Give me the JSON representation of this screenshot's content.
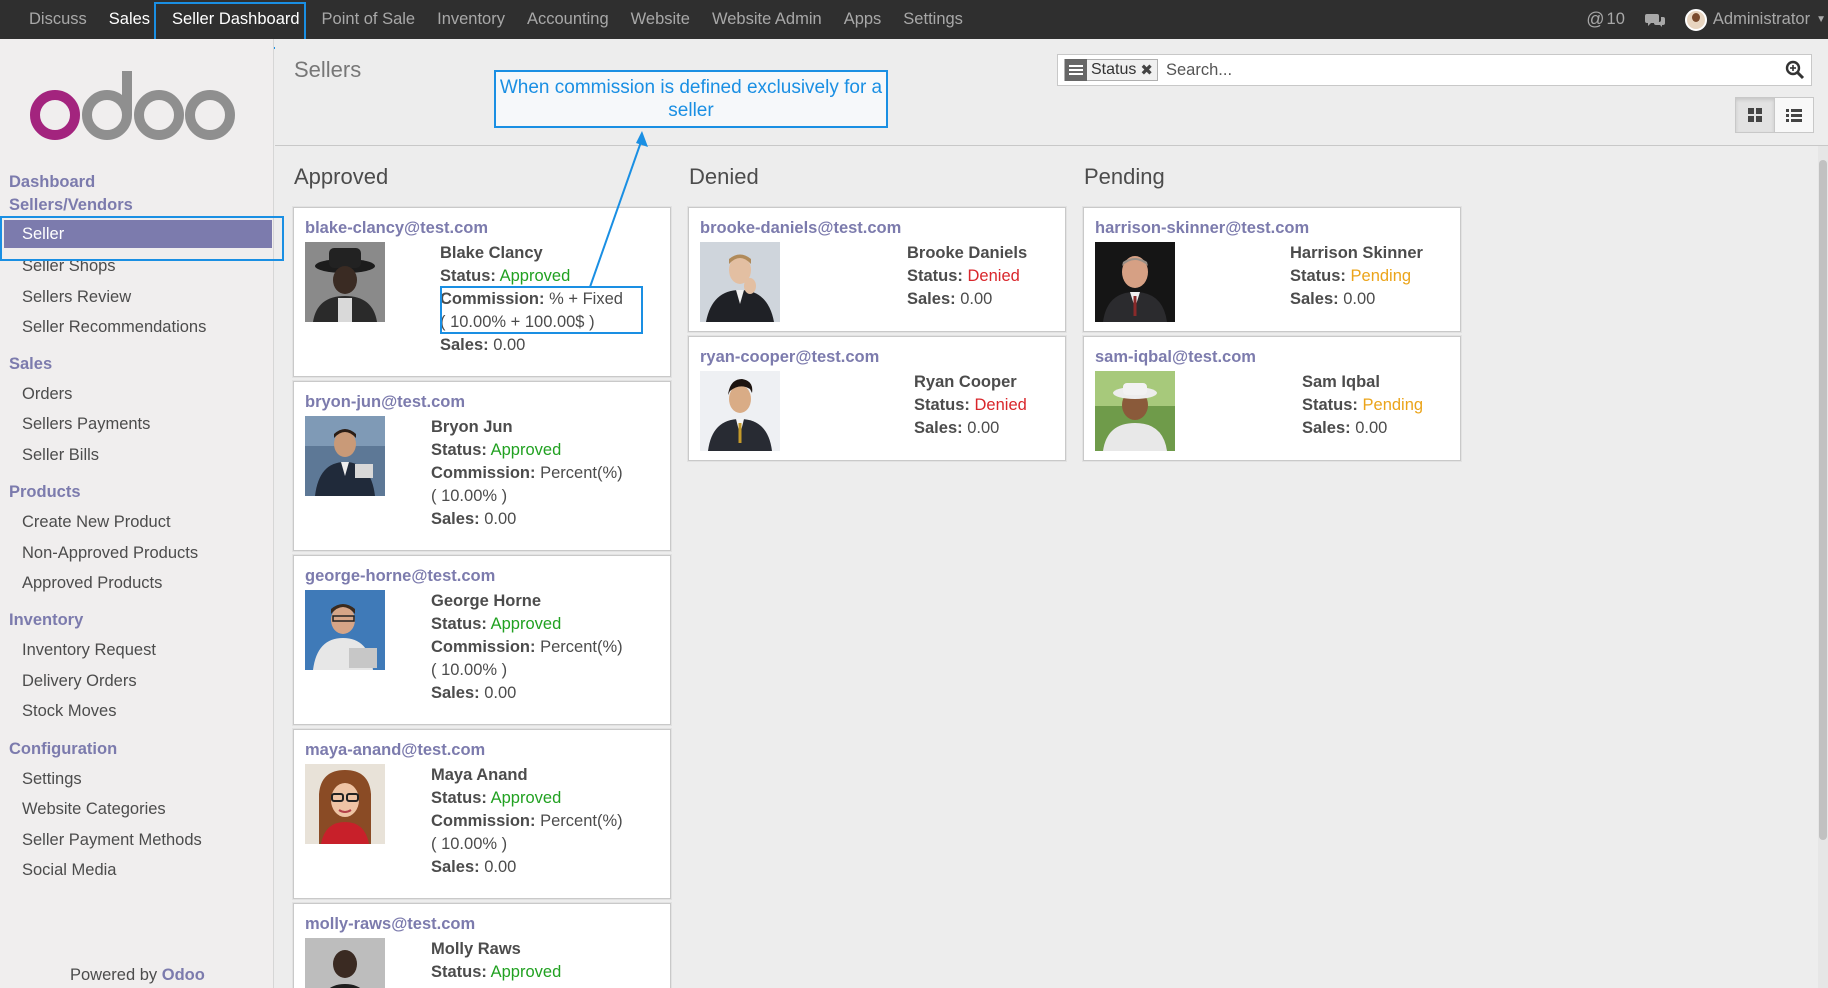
{
  "topbar": {
    "menu": [
      "Discuss",
      "Sales",
      "Seller Dashboard",
      "Point of Sale",
      "Inventory",
      "Accounting",
      "Website",
      "Website Admin",
      "Apps",
      "Settings"
    ],
    "mentions": "10",
    "user": "Administrator",
    "icons": [
      "at-icon",
      "chat-icon",
      "avatar",
      "caret-down-icon"
    ]
  },
  "sidebar": {
    "groups": {
      "dashboard": "Dashboard",
      "sellers": "Sellers/Vendors",
      "sales": "Sales",
      "products": "Products",
      "inventory": "Inventory",
      "configuration": "Configuration"
    },
    "active": "Seller",
    "items": {
      "shops": "Seller Shops",
      "review": "Sellers Review",
      "recommend": "Seller Recommendations",
      "orders": "Orders",
      "payments": "Sellers Payments",
      "bills": "Seller Bills",
      "create": "Create New Product",
      "nonapproved": "Non-Approved Products",
      "approved": "Approved Products",
      "invreq": "Inventory Request",
      "delivery": "Delivery Orders",
      "stock": "Stock Moves",
      "settings": "Settings",
      "webcat": "Website Categories",
      "paymeth": "Seller Payment Methods",
      "social": "Social Media"
    },
    "powered_prefix": "Powered by",
    "powered_brand": "Odoo"
  },
  "control": {
    "title": "Sellers",
    "facet": "Status",
    "search_placeholder": "Search..."
  },
  "annotation": {
    "text": "When commission is defined exclusively for a seller"
  },
  "labels": {
    "status": "Status:",
    "commission": "Commission:",
    "sales": "Sales:"
  },
  "columns": {
    "approved": {
      "title": "Approved",
      "cards": [
        {
          "email": "blake-clancy@test.com",
          "name": "Blake Clancy",
          "status": "Approved",
          "commission": "% + Fixed",
          "commission_detail": "( 10.00% + 100.00$ )",
          "sales": "0.00"
        },
        {
          "email": "bryon-jun@test.com",
          "name": "Bryon Jun",
          "status": "Approved",
          "commission": "Percent(%)",
          "commission_detail": "( 10.00% )",
          "sales": "0.00"
        },
        {
          "email": "george-horne@test.com",
          "name": "George Horne",
          "status": "Approved",
          "commission": "Percent(%)",
          "commission_detail": "( 10.00% )",
          "sales": "0.00"
        },
        {
          "email": "maya-anand@test.com",
          "name": "Maya Anand",
          "status": "Approved",
          "commission": "Percent(%)",
          "commission_detail": "( 10.00% )",
          "sales": "0.00"
        },
        {
          "email": "molly-raws@test.com",
          "name": "Molly Raws",
          "status": "Approved"
        }
      ]
    },
    "denied": {
      "title": "Denied",
      "cards": [
        {
          "email": "brooke-daniels@test.com",
          "name": "Brooke Daniels",
          "status": "Denied",
          "sales": "0.00"
        },
        {
          "email": "ryan-cooper@test.com",
          "name": "Ryan Cooper",
          "status": "Denied",
          "sales": "0.00"
        }
      ]
    },
    "pending": {
      "title": "Pending",
      "cards": [
        {
          "email": "harrison-skinner@test.com",
          "name": "Harrison Skinner",
          "status": "Pending",
          "sales": "0.00"
        },
        {
          "email": "sam-iqbal@test.com",
          "name": "Sam Iqbal",
          "status": "Pending",
          "sales": "0.00"
        }
      ]
    }
  },
  "colors": {
    "brand": "#7c7bad",
    "approved": "#21a121",
    "denied": "#d9262b",
    "pending": "#eba41a",
    "annotation": "#1a8fe3"
  }
}
